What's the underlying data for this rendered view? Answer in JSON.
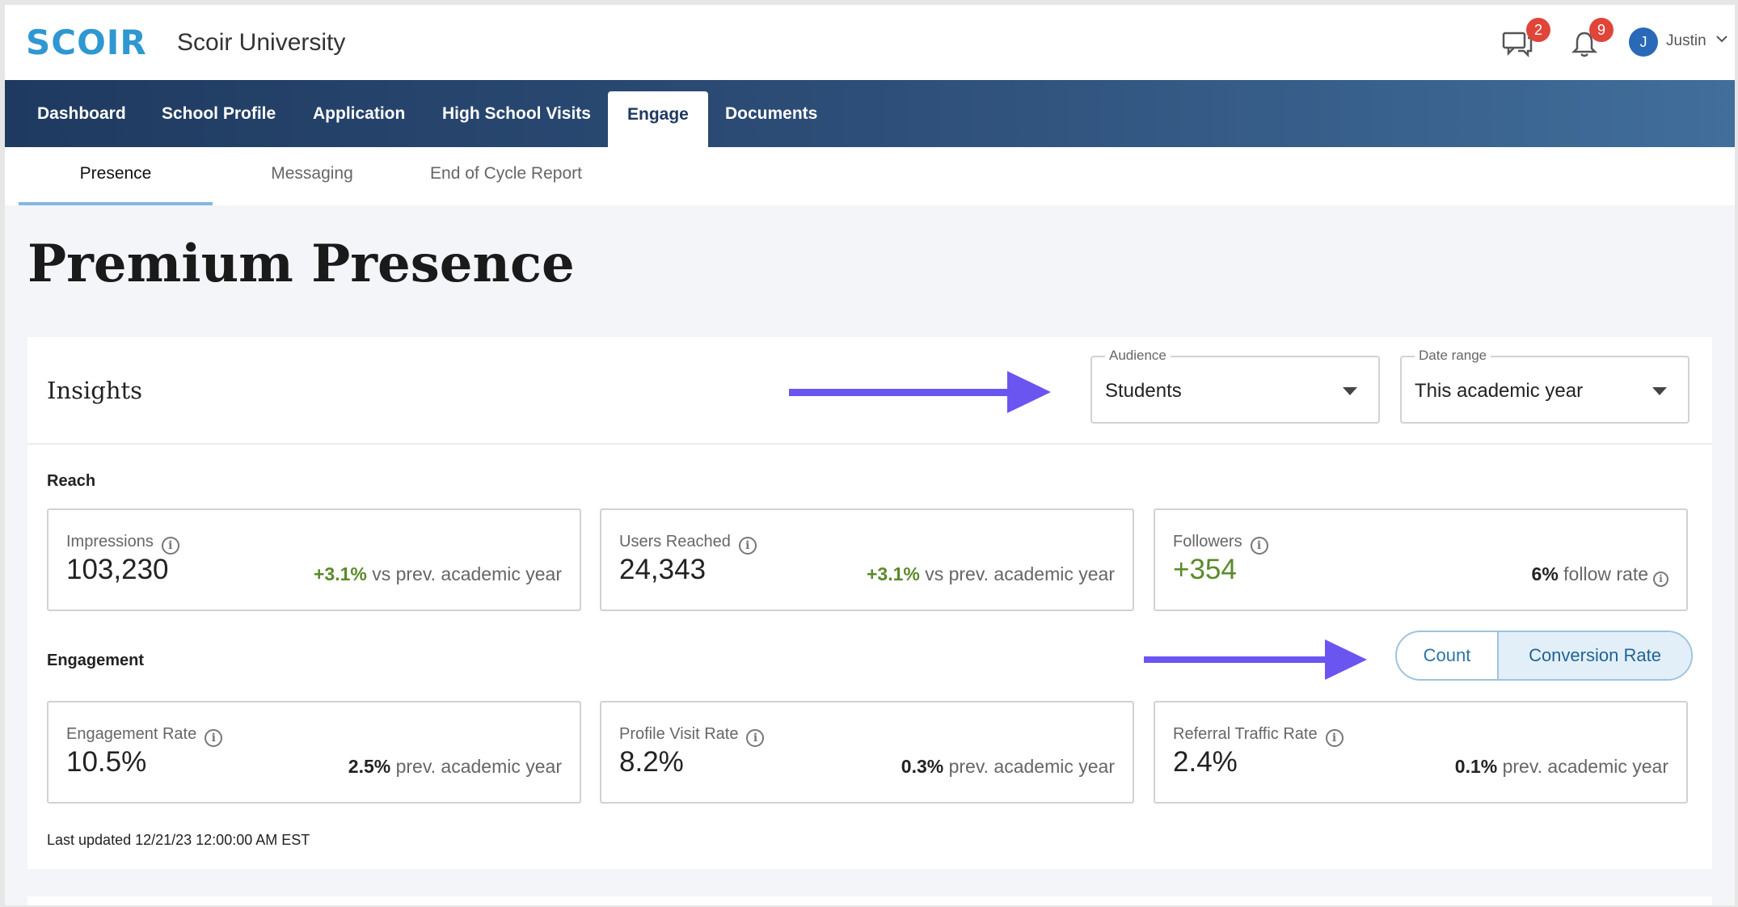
{
  "header": {
    "logo": "SCOIR",
    "org_name": "Scoir University",
    "messages_badge": "2",
    "notifications_badge": "9",
    "user_initial": "J",
    "user_name": "Justin"
  },
  "nav": {
    "items": [
      {
        "label": "Dashboard"
      },
      {
        "label": "School Profile"
      },
      {
        "label": "Application"
      },
      {
        "label": "High School Visits"
      },
      {
        "label": "Engage"
      },
      {
        "label": "Documents"
      }
    ],
    "active": "Engage"
  },
  "subtabs": {
    "items": [
      {
        "label": "Presence"
      },
      {
        "label": "Messaging"
      },
      {
        "label": "End of Cycle Report"
      }
    ],
    "active": "Presence"
  },
  "page": {
    "title": "Premium Presence"
  },
  "insights": {
    "title": "Insights",
    "audience": {
      "label": "Audience",
      "value": "Students"
    },
    "date_range": {
      "label": "Date range",
      "value": "This academic year"
    }
  },
  "reach": {
    "label": "Reach",
    "metrics": [
      {
        "label": "Impressions",
        "value": "103,230",
        "delta": "+3.1%",
        "comparison": "vs prev. academic year"
      },
      {
        "label": "Users Reached",
        "value": "24,343",
        "delta": "+3.1%",
        "comparison": "vs prev. academic year"
      },
      {
        "label": "Followers",
        "value": "+354",
        "delta": "6%",
        "comparison": "follow rate"
      }
    ]
  },
  "engagement": {
    "label": "Engagement",
    "toggle": {
      "count": "Count",
      "rate": "Conversion Rate",
      "selected": "Conversion Rate"
    },
    "metrics": [
      {
        "label": "Engagement Rate",
        "value": "10.5%",
        "delta": "2.5%",
        "comparison": "prev. academic year"
      },
      {
        "label": "Profile Visit Rate",
        "value": "8.2%",
        "delta": "0.3%",
        "comparison": "prev. academic year"
      },
      {
        "label": "Referral Traffic Rate",
        "value": "2.4%",
        "delta": "0.1%",
        "comparison": "prev. academic year"
      }
    ]
  },
  "footer": {
    "last_updated": "Last updated 12/21/23 12:00:00 AM EST"
  },
  "colors": {
    "brand": "#2f97d1",
    "nav_dark": "#1f3a60",
    "positive": "#5a8a2a",
    "badge": "#e0453a",
    "annotation_arrow": "#6b55f0"
  }
}
